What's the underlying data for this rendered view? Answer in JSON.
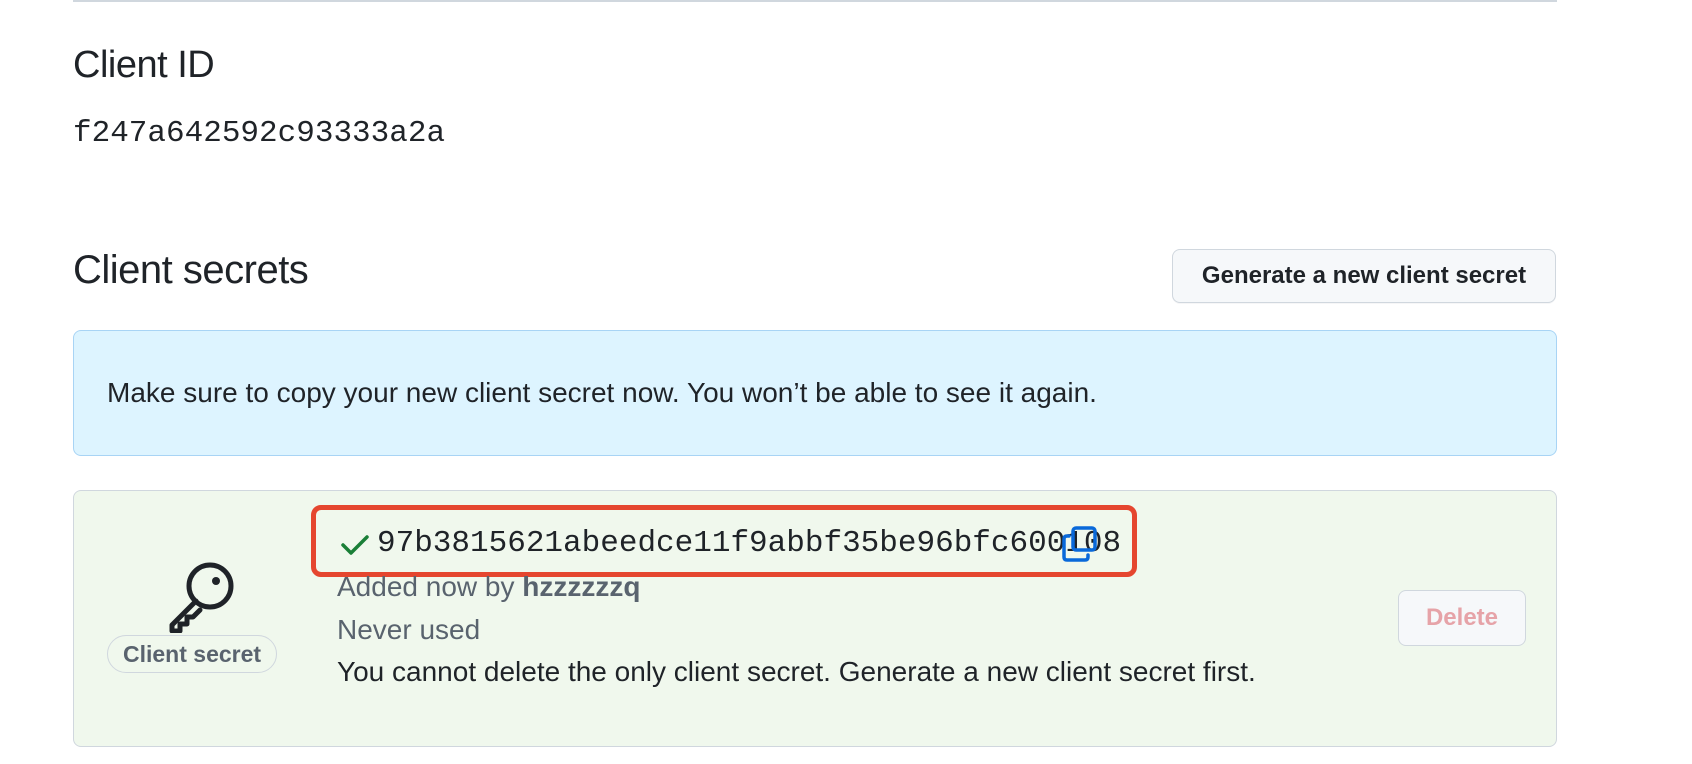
{
  "client_id": {
    "heading": "Client ID",
    "value": "f247a642592c93333a2a"
  },
  "client_secrets": {
    "heading": "Client secrets",
    "generate_button_label": "Generate a new client secret",
    "notice": "Make sure to copy your new client secret now. You won’t be able to see it again.",
    "secret": {
      "badge_label": "Client secret",
      "value": "97b3815621abeedce11f9abbf35be96bfc600108",
      "added_prefix": "Added now by",
      "added_by": "hzzzzzzq",
      "usage": "Never used",
      "delete_warning": "You cannot delete the only client secret. Generate a new client secret first.",
      "delete_button_label": "Delete",
      "delete_disabled": true
    }
  },
  "icons": {
    "key": "key-icon",
    "check": "check-icon",
    "copy": "copy-icon"
  },
  "colors": {
    "info_background": "#ddf4ff",
    "secret_background": "#f0f8ed",
    "success_check": "#1a7f37",
    "copy_icon": "#0969da",
    "highlight_border": "#e5462f",
    "delete_disabled_text": "#e6a3a8"
  }
}
